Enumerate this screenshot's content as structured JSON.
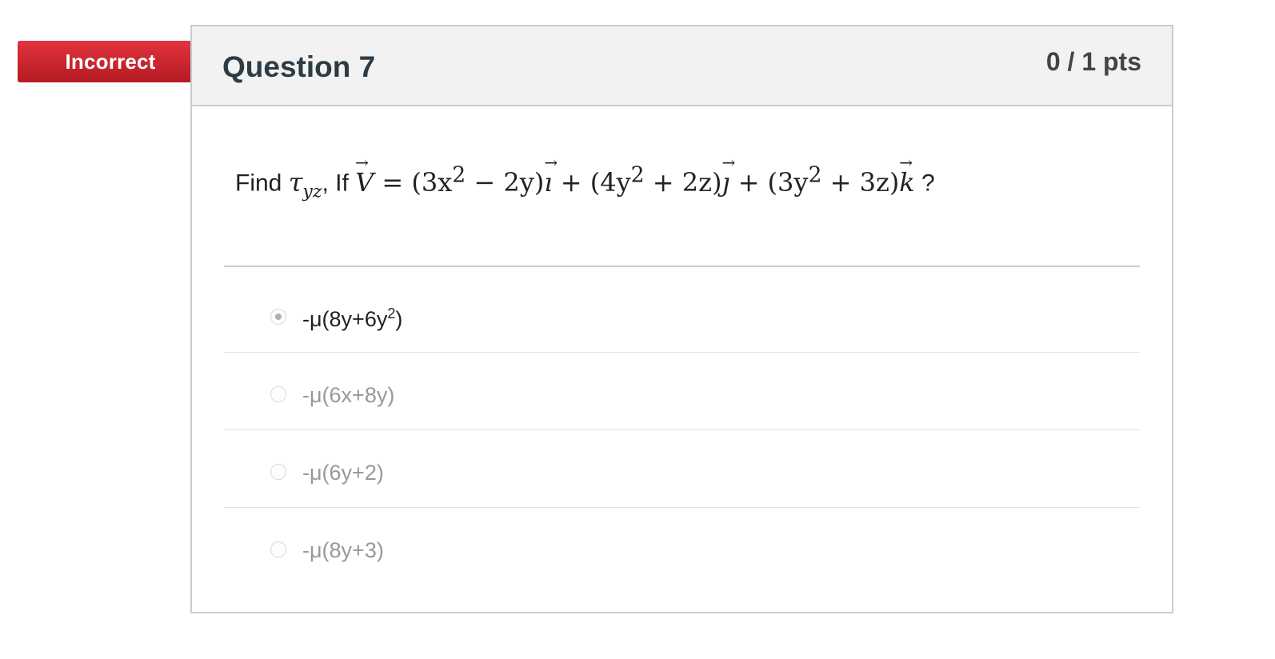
{
  "status_badge": {
    "label": "Incorrect",
    "color": "#c8222c"
  },
  "question": {
    "title": "Question 7",
    "points": "0 / 1 pts",
    "prompt_prefix": "Find",
    "tau": "τ",
    "tau_sub": "yz",
    "if_text": ", If",
    "V": "V",
    "equals": " = (3x",
    "sq1": "2",
    "part2": " − 2y)",
    "i": "ı",
    "part3": " + (4y",
    "sq2": "2",
    "part4": " + 2z)",
    "j": "ȷ",
    "part5": " + (3y",
    "sq3": "2",
    "part6": " + 3z)",
    "k": "k",
    "question_mark": " ?"
  },
  "answers": [
    {
      "text": "-μ(8y+6y",
      "sup": "2",
      "close": ")",
      "selected": true
    },
    {
      "text": "-μ(6x+8y)",
      "sup": "",
      "close": "",
      "selected": false
    },
    {
      "text": "-μ(6y+2)",
      "sup": "",
      "close": "",
      "selected": false
    },
    {
      "text": "-μ(8y+3)",
      "sup": "",
      "close": "",
      "selected": false
    }
  ]
}
